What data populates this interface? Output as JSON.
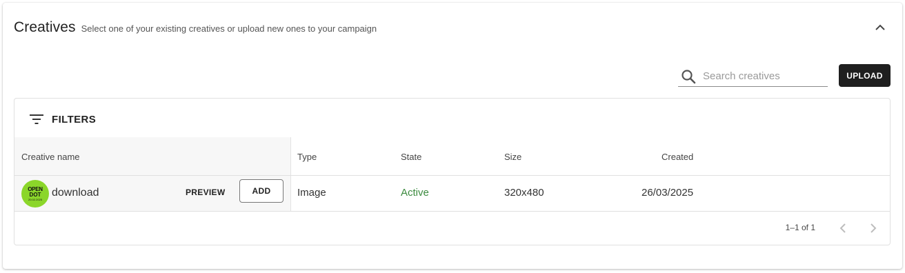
{
  "panel": {
    "title": "Creatives",
    "subtitle": "Select one of your existing creatives or upload new ones to your campaign"
  },
  "search": {
    "placeholder": "Search creatives",
    "value": ""
  },
  "toolbar": {
    "upload_label": "UPLOAD"
  },
  "filters": {
    "label": "FILTERS"
  },
  "table": {
    "columns": [
      "Creative name",
      "Type",
      "State",
      "Size",
      "Created"
    ],
    "rows": [
      {
        "name": "download",
        "thumbnail_text": [
          "OPEN",
          "DOT",
          "20.02.2025"
        ],
        "preview_label": "PREVIEW",
        "add_label": "ADD",
        "type": "Image",
        "state": "Active",
        "size": "320x480",
        "created": "26/03/2025"
      }
    ]
  },
  "pagination": {
    "info": "1–1 of 1"
  },
  "icons": {
    "collapse": "chevron-up-icon",
    "search": "search-icon",
    "filters": "filter-list-icon",
    "prev": "chevron-left-icon",
    "next": "chevron-right-icon"
  },
  "colors": {
    "accent_dark": "#1f1f1f",
    "active_state": "#3b8a3e",
    "thumbnail_bg": "#8bd62a"
  }
}
